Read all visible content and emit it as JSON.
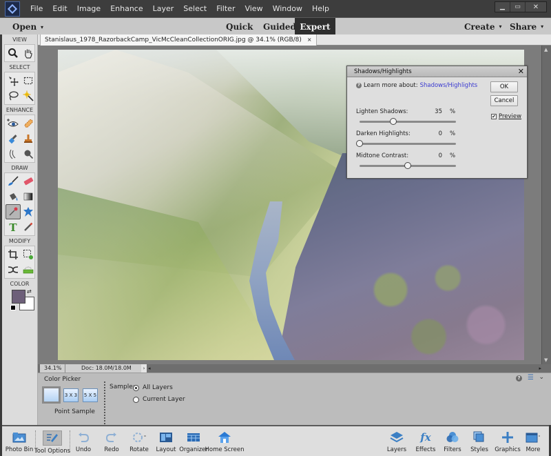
{
  "menubar": {
    "items": [
      "File",
      "Edit",
      "Image",
      "Enhance",
      "Layer",
      "Select",
      "Filter",
      "View",
      "Window",
      "Help"
    ],
    "window_controls": {
      "minimize": "▁",
      "maximize": "▭",
      "close": "✕"
    }
  },
  "modebar": {
    "open_label": "Open",
    "modes": [
      "Quick",
      "Guided",
      "Expert"
    ],
    "active_mode": "Expert",
    "create_label": "Create",
    "share_label": "Share"
  },
  "toolbox": {
    "sections": [
      {
        "title": "VIEW",
        "tools": [
          {
            "name": "zoom",
            "glyph": "🔍"
          },
          {
            "name": "hand",
            "glyph": "✋"
          }
        ]
      },
      {
        "title": "SELECT",
        "tools": [
          {
            "name": "move",
            "glyph": "✥"
          },
          {
            "name": "marquee",
            "glyph": "⬚"
          },
          {
            "name": "lasso",
            "glyph": "➰"
          },
          {
            "name": "magic-wand",
            "glyph": "✳"
          }
        ]
      },
      {
        "title": "ENHANCE",
        "tools": [
          {
            "name": "red-eye",
            "glyph": "👁"
          },
          {
            "name": "spot-healing",
            "glyph": "🩹"
          },
          {
            "name": "smart-brush",
            "glyph": "🖌"
          },
          {
            "name": "clone-stamp",
            "glyph": "⚲"
          },
          {
            "name": "blur",
            "glyph": "☝"
          },
          {
            "name": "sponge",
            "glyph": "⚫"
          }
        ]
      },
      {
        "title": "DRAW",
        "tools": [
          {
            "name": "brush",
            "glyph": "🖌"
          },
          {
            "name": "eraser",
            "glyph": "▰"
          },
          {
            "name": "paint-bucket",
            "glyph": "🪣"
          },
          {
            "name": "gradient",
            "glyph": "▦"
          },
          {
            "name": "eyedropper",
            "glyph": "💉"
          },
          {
            "name": "custom-shape",
            "glyph": "✦"
          },
          {
            "name": "type",
            "glyph": "T"
          },
          {
            "name": "pencil",
            "glyph": "✏"
          }
        ]
      },
      {
        "title": "MODIFY",
        "tools": [
          {
            "name": "crop",
            "glyph": "⌗"
          },
          {
            "name": "recompose",
            "glyph": "⚙"
          },
          {
            "name": "content-move",
            "glyph": "⤨"
          },
          {
            "name": "straighten",
            "glyph": "▬"
          }
        ]
      },
      {
        "title": "COLOR"
      }
    ],
    "active_tool": "eyedropper",
    "foreground_color": "#6d5f79",
    "background_color": "#ffffff"
  },
  "document": {
    "tab_title": "Stanislaus_1978_RazorbackCamp_VicMcCleanCollectionORIG.jpg @ 34.1% (RGB/8)",
    "close_glyph": "×",
    "zoom_level": "34.1%",
    "doc_size": "Doc: 18.0M/18.0M"
  },
  "tool_options": {
    "title": "Color Picker",
    "sample_sizes": [
      "",
      "3 X 3",
      "5 X 5"
    ],
    "selected_sample_label": "Point Sample",
    "sample_label": "Sample:",
    "sample_options": [
      "All Layers",
      "Current Layer"
    ],
    "selected_sample_option": "All Layers"
  },
  "bottombar": {
    "left": [
      {
        "id": "photo-bin",
        "label": "Photo Bin",
        "glyph": "🖼"
      },
      {
        "id": "tool-options",
        "label": "Tool Options",
        "glyph": "✎"
      },
      {
        "id": "undo",
        "label": "Undo",
        "glyph": "↶"
      },
      {
        "id": "redo",
        "label": "Redo",
        "glyph": "↷"
      },
      {
        "id": "rotate",
        "label": "Rotate",
        "glyph": "⟳"
      },
      {
        "id": "layout",
        "label": "Layout",
        "glyph": "▥"
      },
      {
        "id": "organizer",
        "label": "Organizer",
        "glyph": "▤"
      },
      {
        "id": "home-screen",
        "label": "Home Screen",
        "glyph": "⌂"
      }
    ],
    "right": [
      {
        "id": "layers",
        "label": "Layers",
        "glyph": "◈"
      },
      {
        "id": "effects",
        "label": "Effects",
        "glyph": "fx"
      },
      {
        "id": "filters",
        "label": "Filters",
        "glyph": "❂"
      },
      {
        "id": "styles",
        "label": "Styles",
        "glyph": "❐"
      },
      {
        "id": "graphics",
        "label": "Graphics",
        "glyph": "+"
      },
      {
        "id": "more",
        "label": "More",
        "glyph": "▭"
      }
    ]
  },
  "dialog": {
    "title": "Shadows/Highlights",
    "learn_prefix": "Learn more about:",
    "learn_link": "Shadows/Highlights",
    "ok_label": "OK",
    "cancel_label": "Cancel",
    "preview_label": "Preview",
    "preview_checked": true,
    "sliders": [
      {
        "label": "Lighten Shadows:",
        "value": 35,
        "unit": "%",
        "min": 0,
        "max": 100
      },
      {
        "label": "Darken Highlights:",
        "value": 0,
        "unit": "%",
        "min": 0,
        "max": 100
      },
      {
        "label": "Midtone Contrast:",
        "value": 0,
        "unit": "%",
        "min": -100,
        "max": 100
      }
    ]
  }
}
